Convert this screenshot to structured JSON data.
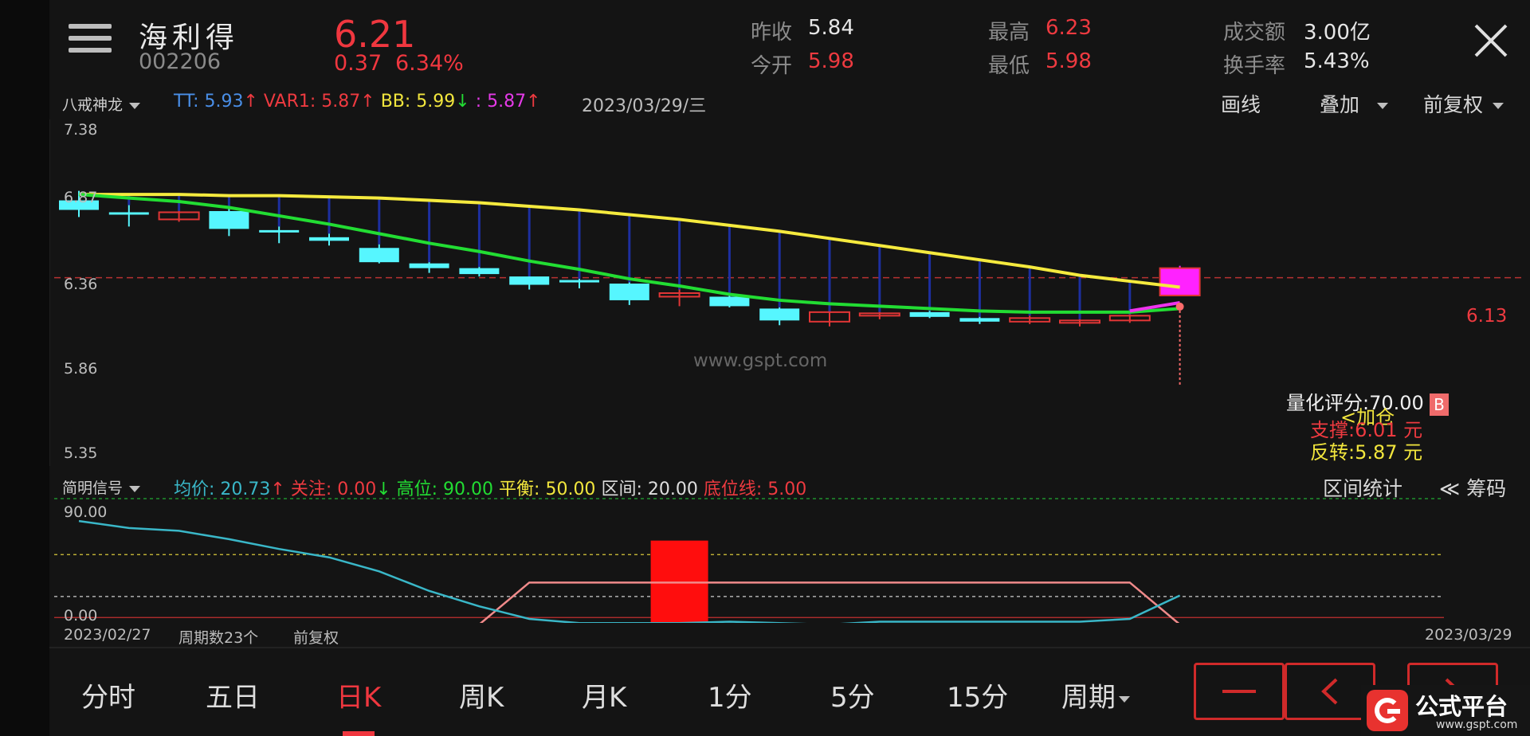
{
  "header": {
    "stock_name": "海利得",
    "stock_code": "002206",
    "price": "6.21",
    "change": "0.37",
    "change_pct": "6.34%",
    "quotes": [
      {
        "label": "昨收",
        "value": "5.84",
        "color": "#e6e6e6"
      },
      {
        "label": "今开",
        "value": "5.98",
        "color": "#ee3a40"
      },
      {
        "label": "最高",
        "value": "6.23",
        "color": "#ee3a40"
      },
      {
        "label": "最低",
        "value": "5.98",
        "color": "#ee3a40"
      },
      {
        "label": "成交额",
        "value": "3.00亿",
        "color": "#e6e6e6"
      },
      {
        "label": "换手率",
        "value": "5.43%",
        "color": "#e6e6e6"
      }
    ]
  },
  "main_indicator": {
    "name": "八戒神龙",
    "tt": "TT: 5.93",
    "tt_arrow": "↑",
    "var1": "VAR1: 5.87",
    "var1_arrow": "↑",
    "bb": "BB: 5.99",
    "bb_arrow": "↓",
    "unnamed": ": 5.87",
    "unnamed_arrow": "↑",
    "date": "2023/03/29/三",
    "tools": {
      "draw": "画线",
      "overlay": "叠加",
      "adjust": "前复权"
    }
  },
  "main_chart": {
    "y_ticks": [
      "7.38",
      "6.87",
      "6.36",
      "5.86",
      "5.35"
    ],
    "ref_price_label": "6.13",
    "watermark": "www.gspt.com",
    "score_text": "量化评分:70.00",
    "add_text": "<加仓",
    "support_text": "支撑:6.01 元",
    "reversal_text": "反转:5.87 元",
    "buy_badge": "B"
  },
  "sub_indicator": {
    "name": "简明信号",
    "avg": "均价: 20.73",
    "avg_arrow": "↑",
    "focus": "关注: 0.00",
    "focus_arrow": "↓",
    "high": "高位: 90.00",
    "balance": "平衡: 50.00",
    "range": "区间: 20.00",
    "bottom": "底位线: 5.00",
    "tools": {
      "stats": "区间统计",
      "chips": "≪ 筹码"
    },
    "y_ticks": [
      "90.00",
      "0.00"
    ],
    "footer": {
      "start_date": "2023/02/27",
      "period_count": "周期数23个",
      "adjust": "前复权",
      "end_date": "2023/03/29"
    }
  },
  "periods": [
    "分时",
    "五日",
    "日K",
    "周K",
    "月K",
    "1分",
    "5分",
    "15分",
    "周期"
  ],
  "active_period": "日K",
  "logo": {
    "text": "公式平台",
    "url": "www.gspt.com"
  },
  "chart_data": {
    "type": "candlestick",
    "ylim": [
      5.35,
      7.38
    ],
    "ref_price": 6.13,
    "candles": [
      {
        "o": 6.78,
        "h": 6.86,
        "l": 6.64,
        "c": 6.7
      },
      {
        "o": 6.68,
        "h": 6.74,
        "l": 6.56,
        "c": 6.67
      },
      {
        "o": 6.62,
        "h": 6.69,
        "l": 6.6,
        "c": 6.68
      },
      {
        "o": 6.69,
        "h": 6.71,
        "l": 6.48,
        "c": 6.54
      },
      {
        "o": 6.53,
        "h": 6.56,
        "l": 6.42,
        "c": 6.51
      },
      {
        "o": 6.47,
        "h": 6.5,
        "l": 6.4,
        "c": 6.44
      },
      {
        "o": 6.38,
        "h": 6.41,
        "l": 6.25,
        "c": 6.26
      },
      {
        "o": 6.25,
        "h": 6.26,
        "l": 6.17,
        "c": 6.21
      },
      {
        "o": 6.21,
        "h": 6.22,
        "l": 6.14,
        "c": 6.16
      },
      {
        "o": 6.14,
        "h": 6.14,
        "l": 6.03,
        "c": 6.07
      },
      {
        "o": 6.11,
        "h": 6.12,
        "l": 6.04,
        "c": 6.1
      },
      {
        "o": 6.08,
        "h": 6.09,
        "l": 5.9,
        "c": 5.94
      },
      {
        "o": 5.97,
        "h": 6.03,
        "l": 5.89,
        "c": 6.0
      },
      {
        "o": 5.97,
        "h": 6.0,
        "l": 5.88,
        "c": 5.89
      },
      {
        "o": 5.87,
        "h": 5.88,
        "l": 5.73,
        "c": 5.77
      },
      {
        "o": 5.76,
        "h": 5.84,
        "l": 5.72,
        "c": 5.84
      },
      {
        "o": 5.81,
        "h": 5.84,
        "l": 5.78,
        "c": 5.83
      },
      {
        "o": 5.84,
        "h": 5.85,
        "l": 5.79,
        "c": 5.8
      },
      {
        "o": 5.79,
        "h": 5.8,
        "l": 5.74,
        "c": 5.76
      },
      {
        "o": 5.76,
        "h": 5.81,
        "l": 5.74,
        "c": 5.79
      },
      {
        "o": 5.75,
        "h": 5.78,
        "l": 5.72,
        "c": 5.77
      },
      {
        "o": 5.77,
        "h": 5.82,
        "l": 5.75,
        "c": 5.81
      },
      {
        "o": 5.98,
        "h": 6.23,
        "l": 5.98,
        "c": 6.21
      }
    ],
    "series": [
      {
        "color": "#f5ea3e",
        "values": [
          6.83,
          6.83,
          6.83,
          6.82,
          6.82,
          6.81,
          6.8,
          6.78,
          6.76,
          6.73,
          6.7,
          6.66,
          6.62,
          6.57,
          6.52,
          6.46,
          6.4,
          6.34,
          6.28,
          6.22,
          6.15,
          6.1,
          6.05
        ]
      },
      {
        "color": "#22dd33",
        "values": [
          6.83,
          6.8,
          6.77,
          6.72,
          6.65,
          6.58,
          6.5,
          6.42,
          6.35,
          6.27,
          6.2,
          6.12,
          6.06,
          5.99,
          5.94,
          5.91,
          5.89,
          5.87,
          5.85,
          5.84,
          5.84,
          5.84,
          5.87
        ]
      },
      {
        "color": "#ee33ee",
        "values": [
          null,
          null,
          null,
          null,
          null,
          null,
          null,
          null,
          null,
          null,
          null,
          null,
          null,
          null,
          null,
          null,
          null,
          null,
          null,
          null,
          null,
          5.85,
          5.92
        ]
      }
    ],
    "sub": {
      "ylim": [
        0,
        90
      ],
      "avg_line": [
        74,
        69,
        67,
        61,
        54,
        48,
        38,
        24,
        13,
        4,
        1,
        1,
        1,
        2,
        1,
        0,
        2,
        2,
        2,
        2,
        2,
        4,
        20.73
      ],
      "signal_line": [
        0,
        0,
        0,
        0,
        0,
        0,
        0,
        0,
        0,
        30,
        30,
        30,
        30,
        30,
        30,
        30,
        30,
        30,
        30,
        30,
        30,
        30,
        0
      ],
      "signal_bar_index": 12,
      "levels": [
        90,
        50,
        20,
        5
      ]
    }
  }
}
